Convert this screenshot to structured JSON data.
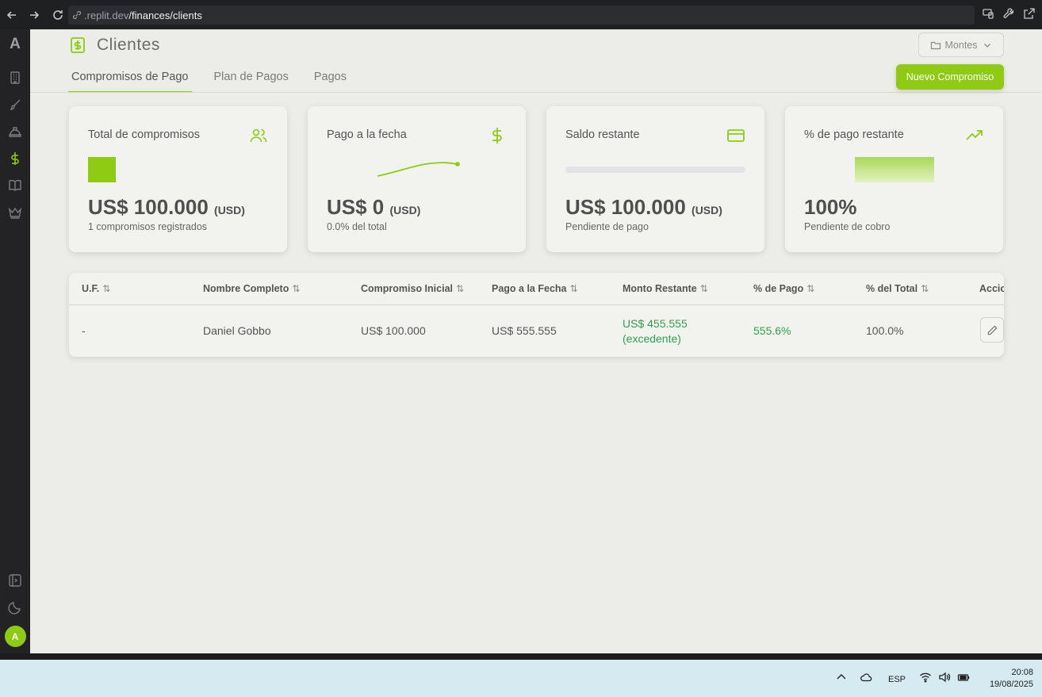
{
  "browser": {
    "url_host": ".replit.dev",
    "url_path": "/finances/clients"
  },
  "sidebar": {
    "logo": "A",
    "avatar": "A"
  },
  "header": {
    "title": "Clientes",
    "selector_label": "Montes",
    "new_button": "Nuevo Compromiso"
  },
  "tabs": [
    {
      "label": "Compromisos de Pago",
      "active": true
    },
    {
      "label": "Plan de Pagos",
      "active": false
    },
    {
      "label": "Pagos",
      "active": false
    }
  ],
  "cards": [
    {
      "label": "Total de compromisos",
      "value": "US$ 100.000",
      "unit": "(USD)",
      "sub": "1 compromisos registrados",
      "icon": "users-icon"
    },
    {
      "label": "Pago a la fecha",
      "value": "US$ 0",
      "unit": "(USD)",
      "sub": "0.0% del total",
      "icon": "dollar-icon"
    },
    {
      "label": "Saldo restante",
      "value": "US$ 100.000",
      "unit": "(USD)",
      "sub": "Pendiente de pago",
      "icon": "credit-card-icon",
      "progress": 0
    },
    {
      "label": "% de pago restante",
      "value": "100%",
      "sub": "Pendiente de cobro",
      "icon": "trending-up-icon"
    }
  ],
  "table": {
    "columns": [
      "U.F.",
      "Nombre Completo",
      "Compromiso Inicial",
      "Pago a la Fecha",
      "Monto Restante",
      "% de Pago",
      "% del Total",
      "Acciones"
    ],
    "rows": [
      {
        "uf": "-",
        "nombre": "Daniel Gobbo",
        "compromiso": "US$ 100.000",
        "pago": "US$ 555.555",
        "restante": "US$ 455.555",
        "restante_note": "(excedente)",
        "pct_pago": "555.6%",
        "pct_total": "100.0%"
      }
    ]
  },
  "taskbar": {
    "lang": "ESP",
    "time": "20:08",
    "date": "19/08/2025"
  },
  "colors": {
    "accent": "#8ecb12",
    "positive": "#2ea24c"
  }
}
